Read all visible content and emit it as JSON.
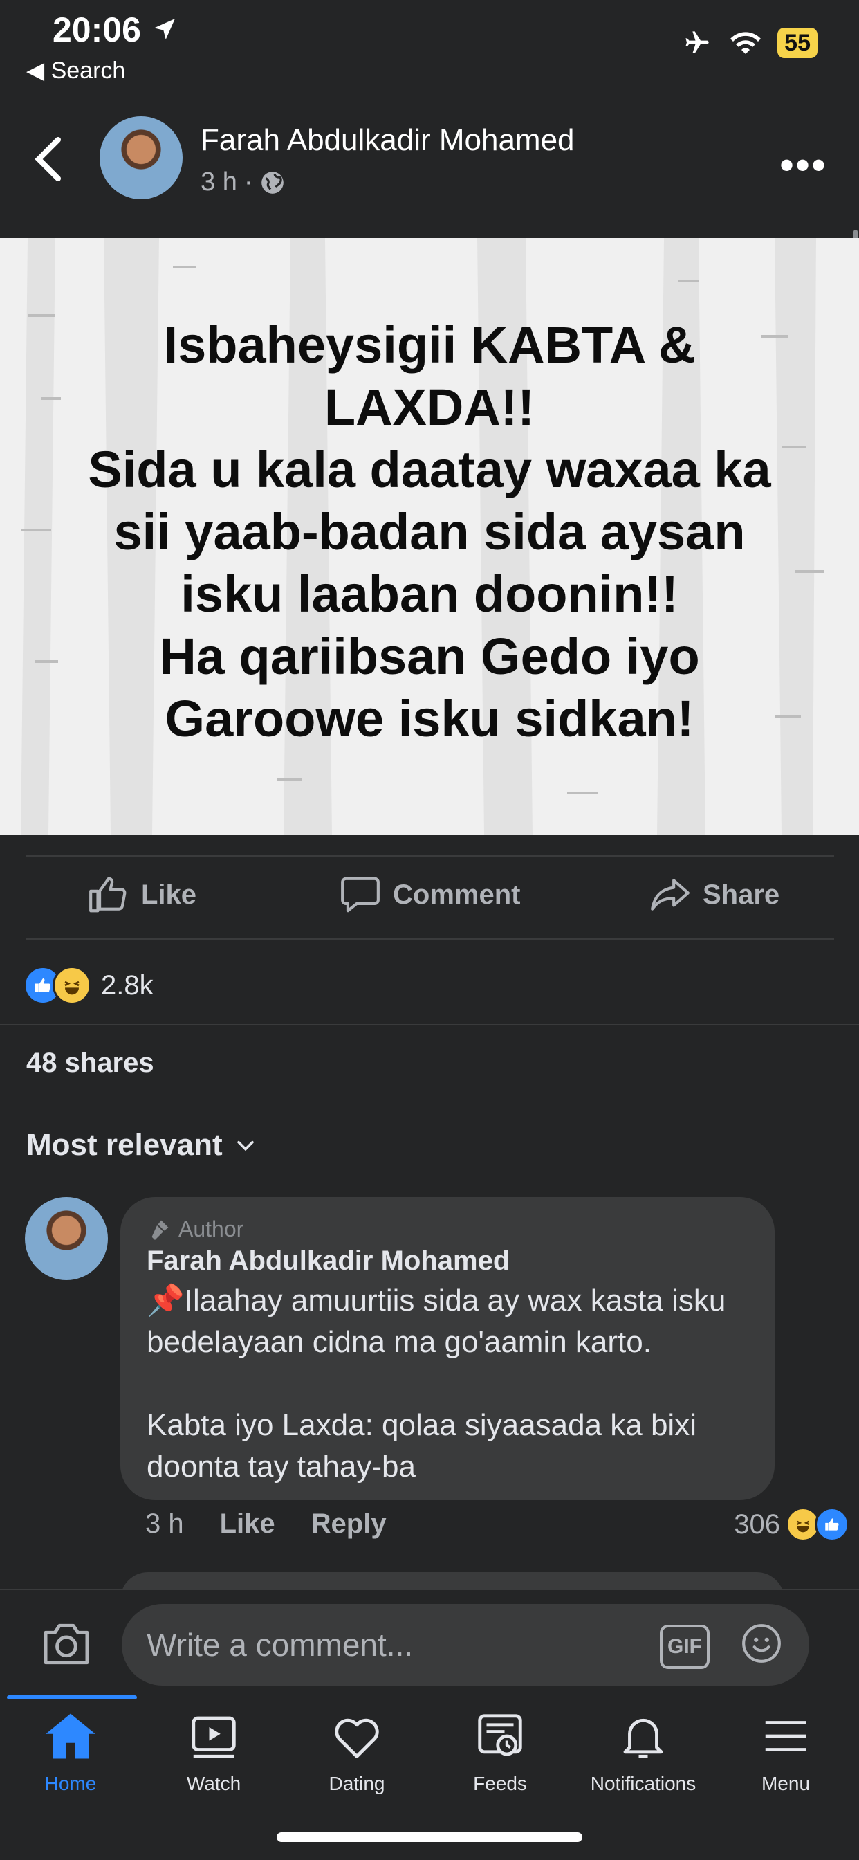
{
  "status_bar": {
    "time": "20:06",
    "back_label": "◀ Search",
    "battery": "55"
  },
  "post": {
    "author": "Farah Abdulkadir Mohamed",
    "time": "3 h",
    "separator": "·",
    "image_text_lines": [
      "Isbaheysigii KABTA &",
      "LAXDA!!",
      "Sida u kala daatay waxaa ka",
      "sii yaab-badan sida aysan",
      "isku laaban doonin!!",
      "Ha qariibsan Gedo iyo",
      "Garoowe isku sidkan!"
    ]
  },
  "actions": {
    "like": "Like",
    "comment": "Comment",
    "share": "Share"
  },
  "reactions": {
    "count": "2.8k"
  },
  "shares": "48 shares",
  "sort": {
    "label": "Most relevant"
  },
  "comment": {
    "tag": "Author",
    "name": "Farah Abdulkadir Mohamed",
    "text": "📌Ilaahay amuurtiis sida ay wax kasta isku bedelayaan cidna ma go'aamin karto.\n\nKabta iyo Laxda: qolaa siyaasada ka bixi doonta tay tahay-ba",
    "time": "3 h",
    "like": "Like",
    "reply": "Reply",
    "reaction_count": "306"
  },
  "composer": {
    "placeholder": "Write a comment...",
    "gif": "GIF"
  },
  "tabs": [
    {
      "label": "Home",
      "icon": "home-icon"
    },
    {
      "label": "Watch",
      "icon": "watch-icon"
    },
    {
      "label": "Dating",
      "icon": "heart-icon"
    },
    {
      "label": "Feeds",
      "icon": "feeds-icon"
    },
    {
      "label": "Notifications",
      "icon": "bell-icon"
    },
    {
      "label": "Menu",
      "icon": "menu-icon"
    }
  ],
  "colors": {
    "accent": "#2d88ff",
    "background": "#242526",
    "bubble": "#3a3b3c",
    "battery": "#f6d34a"
  }
}
